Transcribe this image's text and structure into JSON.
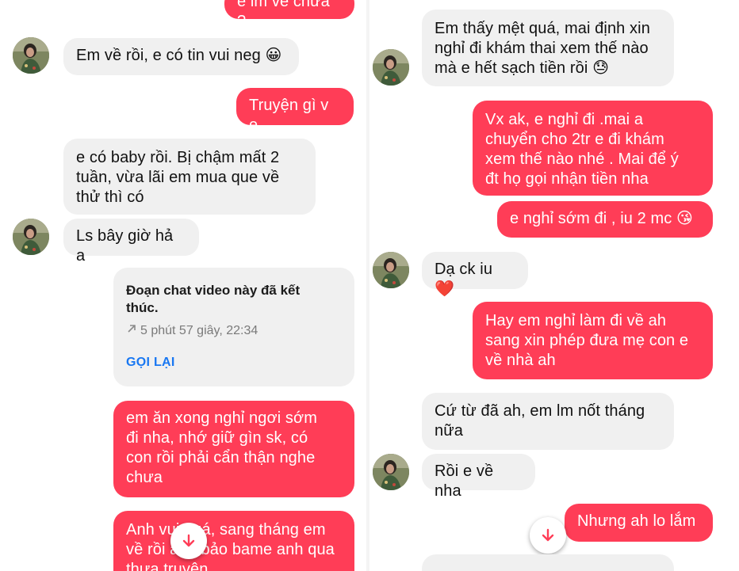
{
  "left": {
    "messages": [
      {
        "text": "e lm về chưa ?"
      },
      {
        "text": "Em về rồi, e có tin vui neg 😀"
      },
      {
        "text": "Truyện gì v e"
      },
      {
        "text": "e có baby rồi. Bị chậm mất 2\ntuần, vừa lãi em mua que về\nthử thì có"
      },
      {
        "text": "Ls bây giờ hả a"
      },
      {
        "text": "em ăn xong nghỉ ngơi sớm\nđi nha, nhớ giữ gìn sk, có\ncon rồi phải cẩn thận nghe\nchưa"
      },
      {
        "text": "Anh vui quá, sang tháng em\nvề rồi anh bảo bame anh qua\nthưa truyện"
      }
    ],
    "call_card": {
      "title": "Đoạn chat video này đã kết\nthúc.",
      "meta": "5 phút 57 giây, 22:34",
      "action": "GỌI LẠI"
    }
  },
  "right": {
    "messages": [
      {
        "text": "Em thấy mệt quá, mai định xin\nnghỉ đi khám thai xem thế nào\nmà e hết sạch tiền rồi 😓"
      },
      {
        "text": "Vx ak, e nghỉ đi .mai a\nchuyển cho 2tr e đi khám\nxem thế nào nhé . Mai để ý\nđt họ gọi nhận tiền nha"
      },
      {
        "text": "e nghỉ sớm đi , iu 2 mc 😘"
      },
      {
        "text": "Dạ ck iu ❤️"
      },
      {
        "text": "Hay em nghỉ làm đi về ah\nsang xin phép đưa mẹ con e\nvề nhà ah"
      },
      {
        "text": "Cứ từ đã ah, em lm nốt tháng\nnữa"
      },
      {
        "text": "Rồi e về nha"
      },
      {
        "text": "Nhưng ah lo lắm"
      }
    ]
  },
  "colors": {
    "outgoing_bubble": "#ff3d57",
    "incoming_bubble": "#f0f0f0",
    "call_action": "#1877f2"
  },
  "icons": [
    "arrow-down-icon",
    "outgoing-call-arrow-icon",
    "contact-avatar"
  ]
}
